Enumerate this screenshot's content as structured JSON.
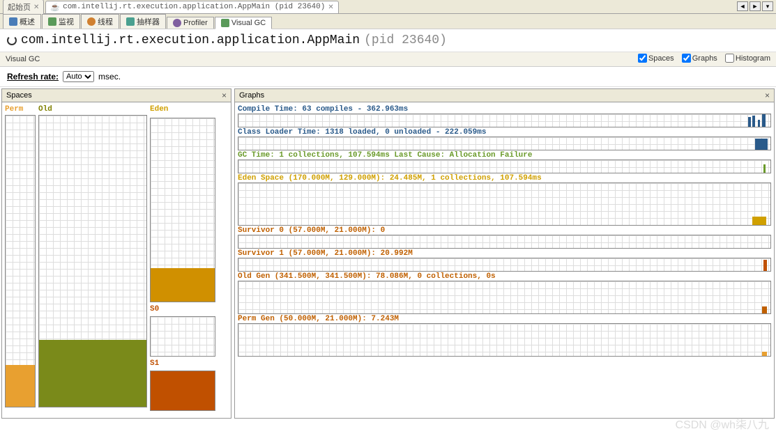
{
  "tabs": {
    "start": "起始页",
    "app": "com.intellij.rt.execution.application.AppMain (pid 23640)"
  },
  "subtabs": {
    "overview": "概述",
    "monitor": "监视",
    "threads": "线程",
    "sampler": "抽样器",
    "profiler": "Profiler",
    "visualgc": "Visual GC"
  },
  "title": {
    "main": "com.intellij.rt.execution.application.AppMain",
    "pid": "(pid 23640)"
  },
  "vgc": {
    "label": "Visual GC",
    "spaces_cb": "Spaces",
    "graphs_cb": "Graphs",
    "histogram_cb": "Histogram"
  },
  "refresh": {
    "label": "Refresh rate:",
    "value": "Auto",
    "unit": "msec."
  },
  "panels": {
    "spaces": "Spaces",
    "graphs": "Graphs"
  },
  "spaces": {
    "perm": "Perm",
    "old": "Old",
    "eden": "Eden",
    "s0": "S0",
    "s1": "S1"
  },
  "graphs": {
    "compile": "Compile Time: 63 compiles - 362.963ms",
    "classloader": "Class Loader Time: 1318 loaded, 0 unloaded - 222.059ms",
    "gctime": "GC Time: 1 collections, 107.594ms Last Cause: Allocation Failure",
    "eden": "Eden Space (170.000M, 129.000M): 24.485M, 1 collections, 107.594ms",
    "s0": "Survivor 0 (57.000M, 21.000M): 0",
    "s1": "Survivor 1 (57.000M, 21.000M): 20.992M",
    "oldgen": "Old Gen (341.500M, 341.500M): 78.086M, 0 collections, 0s",
    "permgen": "Perm Gen (50.000M, 21.000M): 7.243M"
  },
  "chart_data": {
    "spaces": [
      {
        "name": "Perm",
        "capacity_m": 21.0,
        "used_m": 7.243,
        "fill_pct": 14,
        "color": "#e8a030"
      },
      {
        "name": "Old",
        "capacity_m": 341.5,
        "used_m": 78.086,
        "fill_pct": 23,
        "color": "#7a8a1a"
      },
      {
        "name": "Eden",
        "capacity_m": 129.0,
        "used_m": 24.485,
        "fill_pct": 19,
        "color": "#d09000"
      },
      {
        "name": "S0",
        "capacity_m": 21.0,
        "used_m": 0,
        "fill_pct": 0,
        "color": "#c05000"
      },
      {
        "name": "S1",
        "capacity_m": 21.0,
        "used_m": 20.992,
        "fill_pct": 100,
        "color": "#c05000"
      }
    ],
    "graphs": [
      {
        "name": "Compile Time",
        "compiles": 63,
        "time_ms": 362.963
      },
      {
        "name": "Class Loader Time",
        "loaded": 1318,
        "unloaded": 0,
        "time_ms": 222.059
      },
      {
        "name": "GC Time",
        "collections": 1,
        "time_ms": 107.594,
        "last_cause": "Allocation Failure"
      },
      {
        "name": "Eden Space",
        "max_m": 170.0,
        "capacity_m": 129.0,
        "used_m": 24.485,
        "collections": 1,
        "time_ms": 107.594
      },
      {
        "name": "Survivor 0",
        "max_m": 57.0,
        "capacity_m": 21.0,
        "used_m": 0
      },
      {
        "name": "Survivor 1",
        "max_m": 57.0,
        "capacity_m": 21.0,
        "used_m": 20.992
      },
      {
        "name": "Old Gen",
        "max_m": 341.5,
        "capacity_m": 341.5,
        "used_m": 78.086,
        "collections": 0,
        "time_s": 0
      },
      {
        "name": "Perm Gen",
        "max_m": 50.0,
        "capacity_m": 21.0,
        "used_m": 7.243
      }
    ]
  },
  "watermark": "CSDN @wh柒八九"
}
